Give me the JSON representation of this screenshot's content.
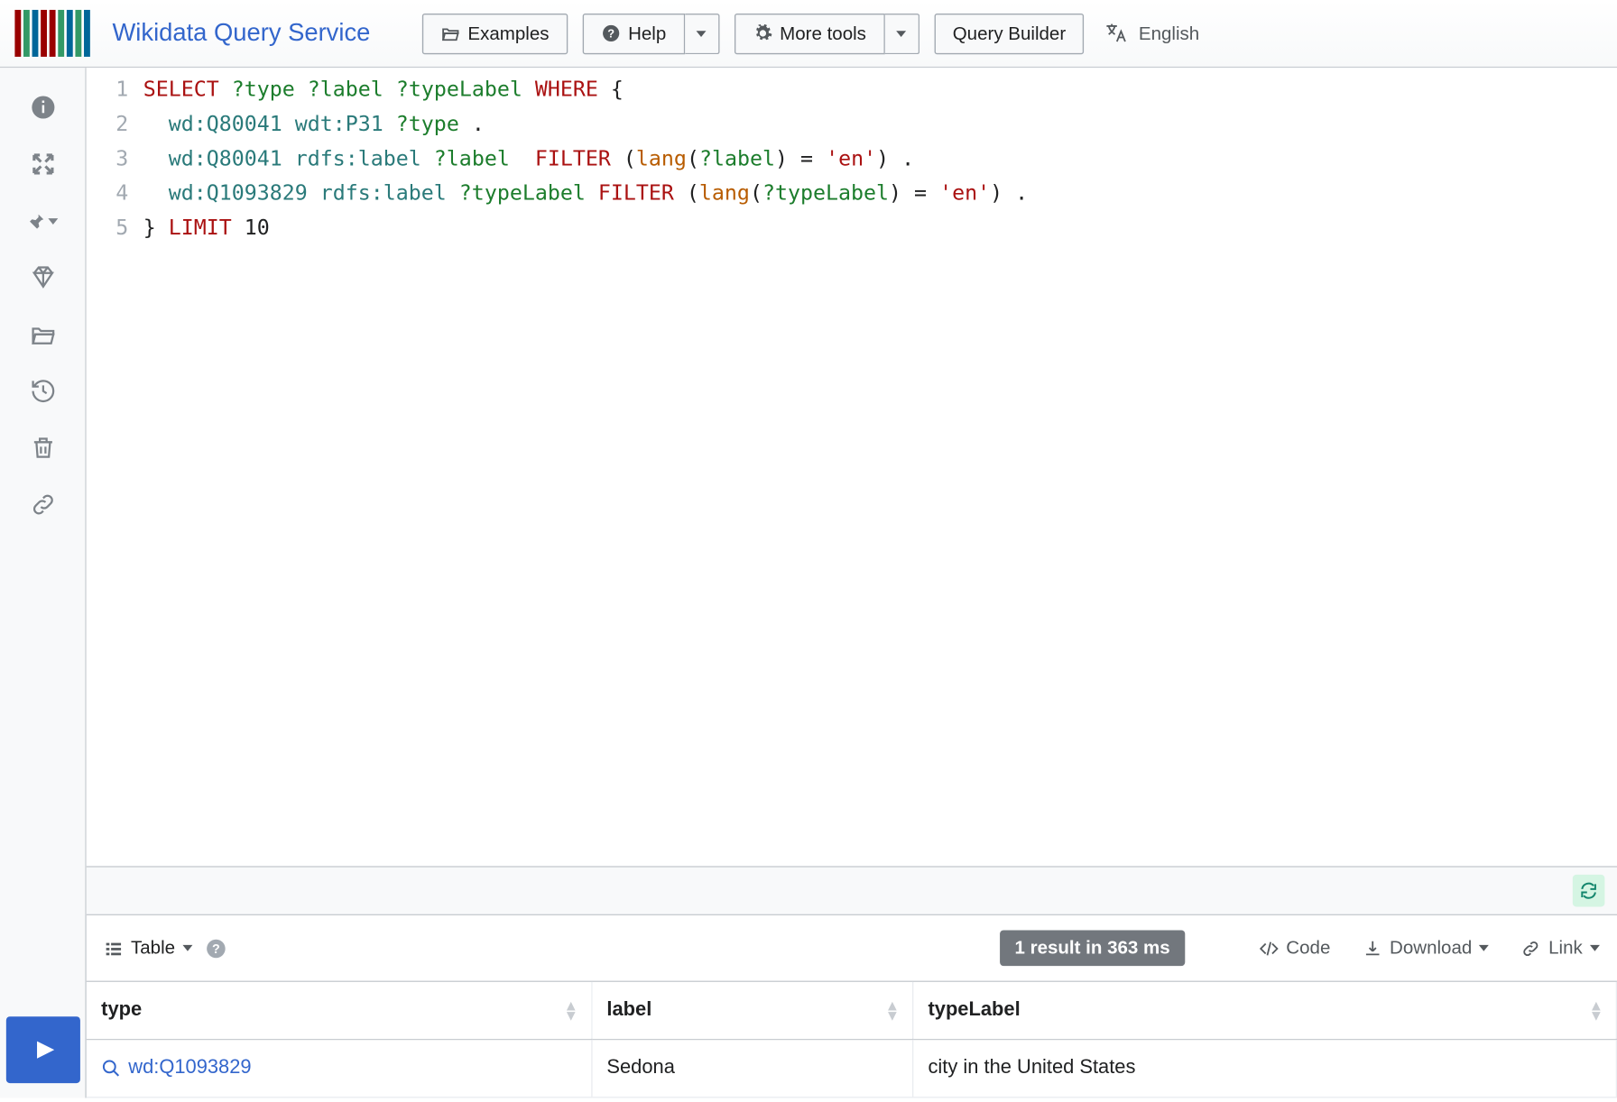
{
  "brand": "Wikidata Query Service",
  "toolbar": {
    "examples": "Examples",
    "help": "Help",
    "more_tools": "More tools",
    "query_builder": "Query Builder",
    "language": "English"
  },
  "editor": {
    "lines": [
      "1",
      "2",
      "3",
      "4",
      "5"
    ],
    "tokens": {
      "select": "SELECT",
      "where": "WHERE",
      "filter": "FILTER",
      "lang": "lang",
      "limit": "LIMIT",
      "limit_n": "10",
      "en": "'en'",
      "v_type": "?type",
      "v_label": "?label",
      "v_typeLabel": "?typeLabel",
      "wd1": "wd:Q80041",
      "wdt": "wdt:P31",
      "rdfs": "rdfs:label",
      "wd2": "wd:Q1093829"
    }
  },
  "status": {
    "badge": "1 result in 363 ms"
  },
  "result_toolbar": {
    "view": "Table",
    "code": "Code",
    "download": "Download",
    "link": "Link"
  },
  "table": {
    "headers": [
      "type",
      "label",
      "typeLabel"
    ],
    "row": {
      "type_link": "wd:Q1093829",
      "label": "Sedona",
      "typeLabel": "city in the United States"
    }
  }
}
